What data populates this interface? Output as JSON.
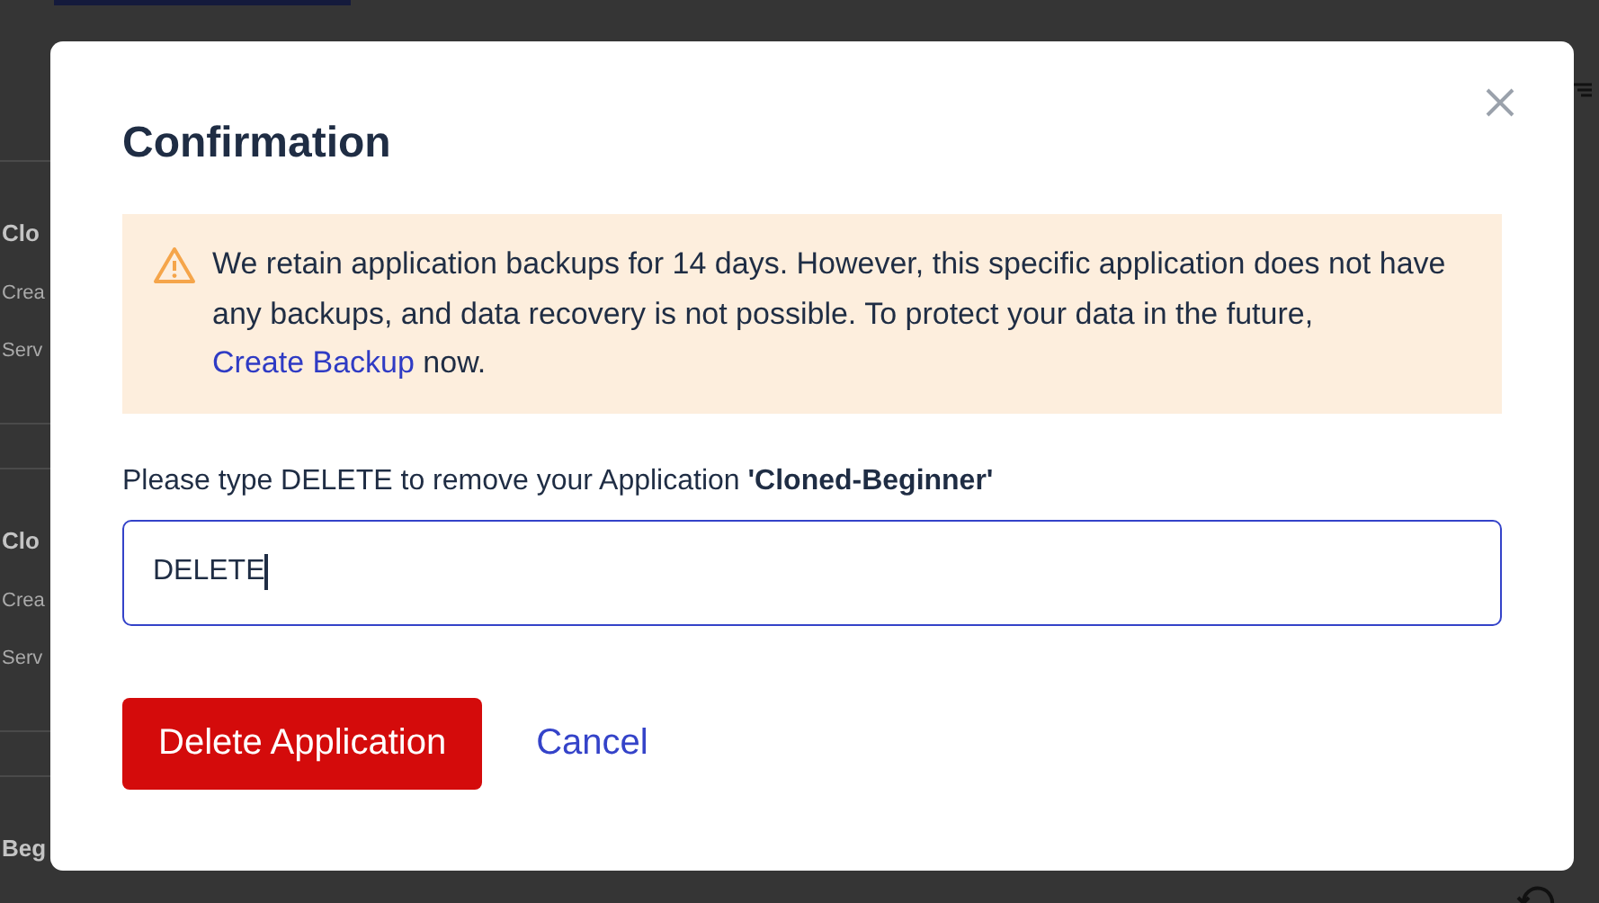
{
  "background": {
    "rows": [
      {
        "title": "Clo",
        "line_1": "Crea",
        "line_2": "Serv"
      },
      {
        "title": "Clo",
        "line_1": "Crea",
        "line_2": "Serv"
      },
      {
        "title": "Beg"
      }
    ]
  },
  "dialog": {
    "title": "Confirmation",
    "alert": {
      "text_before": "We retain application backups for 14 days. However, this specific application does not have any backups, and data recovery is not possible. To protect your data in the future,",
      "link": "Create Backup",
      "text_after": "now."
    },
    "prompt": "Please type DELETE to remove your Application **'Cloned-Beginner'**",
    "input": {
      "value": "DELETE",
      "focused": true
    },
    "buttons": [
      {
        "label": "Delete Application",
        "kind": "primary"
      },
      {
        "label": "Cancel",
        "kind": "link"
      }
    ]
  }
}
